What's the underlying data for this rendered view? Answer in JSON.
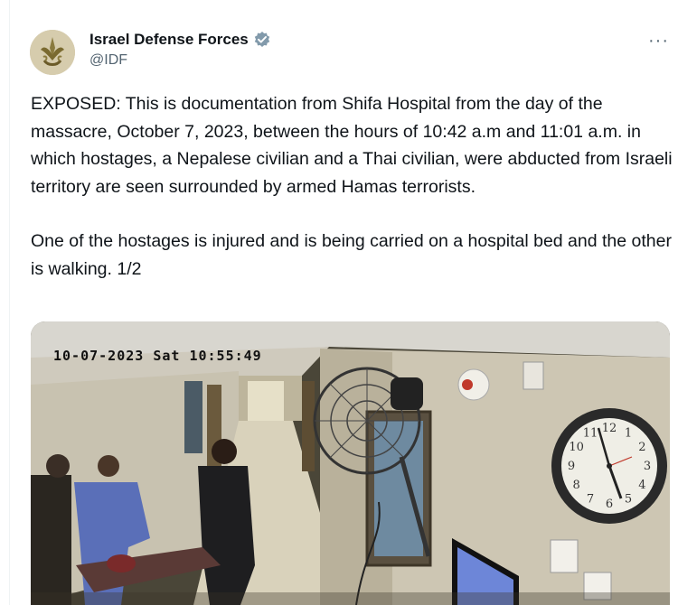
{
  "tweet": {
    "author_name": "Israel Defense Forces",
    "handle": "@IDF",
    "more_label": "···",
    "paragraphs": [
      "EXPOSED: This is documentation from Shifa Hospital from the day of the massacre, October 7, 2023, between the hours of 10:42 a.m and 11:01 a.m. in which hostages, a Nepalese civilian and a Thai civilian, were abducted from Israeli territory are seen surrounded by armed Hamas terrorists.",
      "One of the hostages is injured and is being carried on a hospital bed and the other is walking. 1/2"
    ],
    "media": {
      "timestamp": "10-07-2023 Sat 10:55:49",
      "clock_numbers": [
        "12",
        "1",
        "2",
        "3",
        "4",
        "5",
        "6",
        "7",
        "8",
        "9",
        "10",
        "11"
      ]
    }
  },
  "icons": {
    "verified": "verified-badge-icon",
    "avatar": "idf-emblem-icon"
  },
  "colors": {
    "verified": "#829aab",
    "text": "#0f1419",
    "secondary": "#536471"
  }
}
